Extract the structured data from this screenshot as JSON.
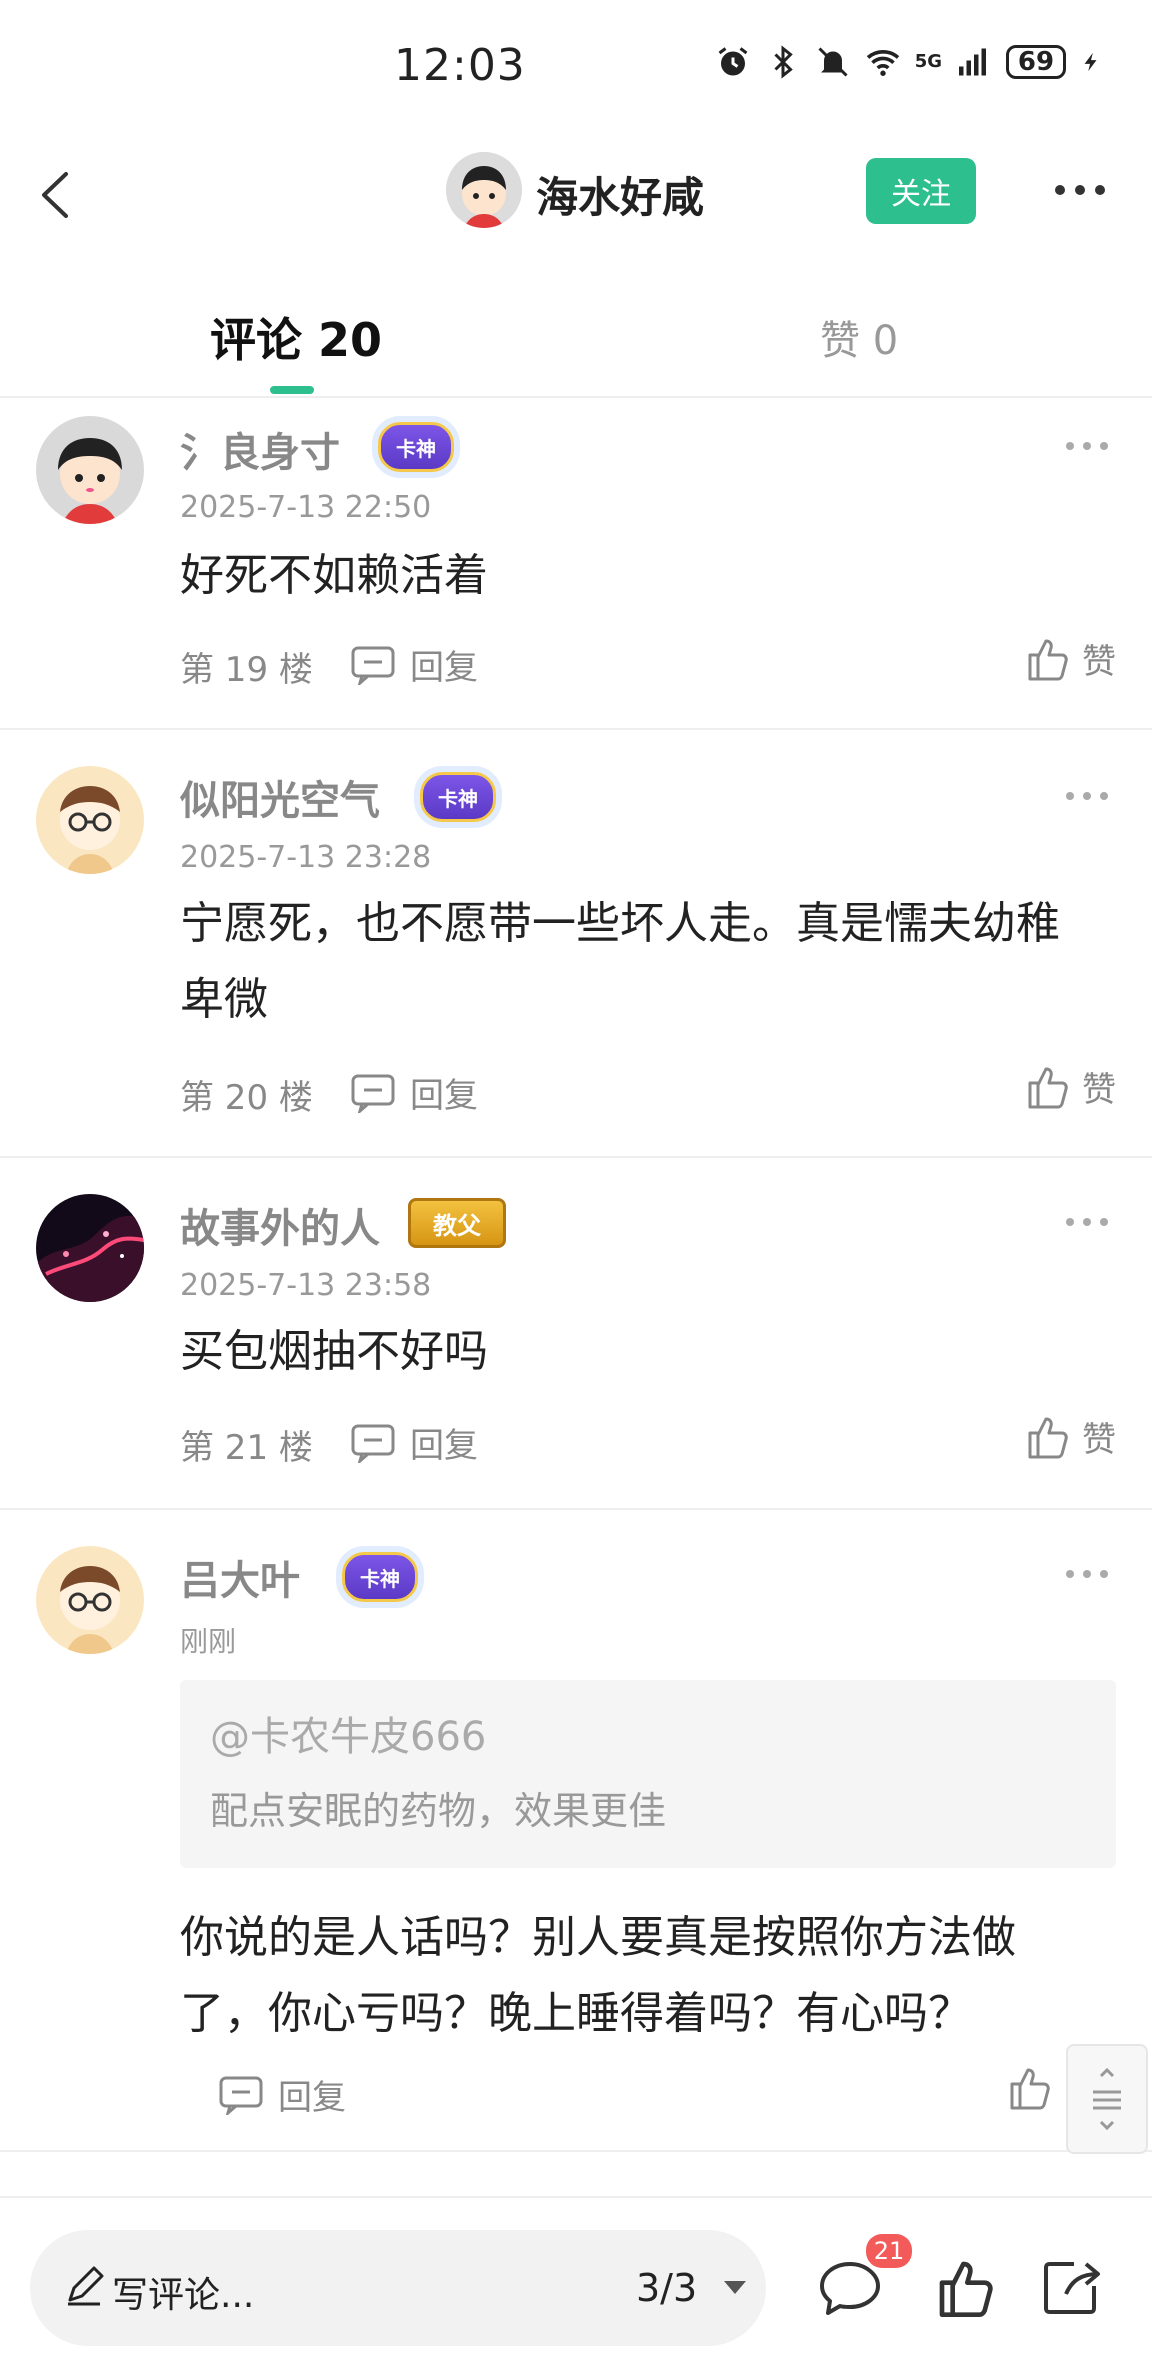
{
  "status_bar": {
    "time": "12:03",
    "network": "5G",
    "battery": "69",
    "icons": [
      "alarm-icon",
      "bluetooth-icon",
      "mute-icon",
      "wifi-icon",
      "signal-icon",
      "battery-icon",
      "charging-icon"
    ]
  },
  "header": {
    "title": "海水好咸",
    "follow_label": "关注",
    "icons": [
      "back-icon",
      "more-icon"
    ]
  },
  "tabs": {
    "comments_label": "评论 20",
    "likes_label": "赞 0"
  },
  "comments": [
    {
      "name": "氵良身寸",
      "badge": "卡神",
      "time": "2025-7-13 22:50",
      "text": "好死不如赖活着",
      "floor": "第 19 楼",
      "reply_label": "回复",
      "like_label": "赞"
    },
    {
      "name": "似阳光空气",
      "badge": "卡神",
      "time": "2025-7-13 23:28",
      "text": "宁愿死，也不愿带一些坏人走。真是懦夫幼稚卑微",
      "floor": "第 20 楼",
      "reply_label": "回复",
      "like_label": "赞"
    },
    {
      "name": "故事外的人",
      "badge": "教父",
      "time": "2025-7-13 23:58",
      "text": "买包烟抽不好吗",
      "floor": "第 21 楼",
      "reply_label": "回复",
      "like_label": "赞"
    },
    {
      "name": "吕大叶",
      "badge": "卡神",
      "time": "刚刚",
      "quote_user": "@卡农牛皮666",
      "quote_text": "配点安眠的药物，效果更佳",
      "text": "你说的是人话吗？别人要真是按照你方法做了，你心亏吗？晚上睡得着吗？有心吗？",
      "reply_label": "回复"
    }
  ],
  "bottom_bar": {
    "write_label": "写评论...",
    "page_indicator": "3/3",
    "comment_count": "21",
    "icons": [
      "pencil-icon",
      "caret-down-icon",
      "comment-icon",
      "like-icon",
      "share-icon"
    ]
  },
  "colors": {
    "accent": "#2dbf8e",
    "badge_red": "#f35b5b",
    "muted_text": "#888888"
  }
}
